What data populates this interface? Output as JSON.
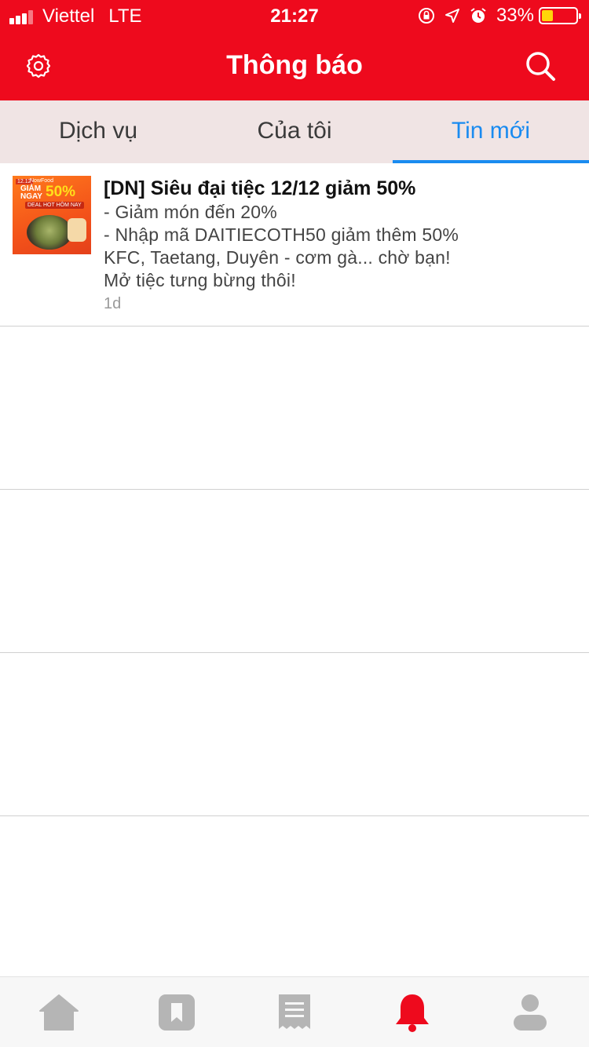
{
  "status_bar": {
    "carrier": "Viettel",
    "network": "LTE",
    "time": "21:27",
    "battery": "33%",
    "battery_level": 0.33
  },
  "header": {
    "title": "Thông báo",
    "bg_color": "#ee0a1d",
    "left_icon": "gear-icon",
    "right_icon": "search-icon"
  },
  "tabs": [
    {
      "label": "Dịch vụ"
    },
    {
      "label": "Của tôi"
    },
    {
      "label": "Tin mới",
      "active": true
    }
  ],
  "notifications": [
    {
      "thumbnail": {
        "tag": "12.12",
        "brand": "NowFood",
        "line1": "GIẢM",
        "line2": "NGAY",
        "percent": "50%",
        "deal": "DEAL HOT HÔM NAY"
      },
      "title": "[DN] Siêu đại tiệc 12/12 giảm 50%",
      "lines": [
        "- Giảm món đến 20%",
        "- Nhập mã DAITIECOTH50 giảm thêm 50%",
        "KFC, Taetang, Duyên - cơm gà... chờ bạn!",
        "Mở tiệc tưng bừng thôi!"
      ],
      "time_ago": "1d"
    }
  ],
  "bottom_tabs": [
    {
      "icon": "home-icon",
      "active": false
    },
    {
      "icon": "bookmark-icon",
      "active": false
    },
    {
      "icon": "receipt-icon",
      "active": false
    },
    {
      "icon": "bell-icon",
      "active": true
    },
    {
      "icon": "profile-icon",
      "active": false
    }
  ],
  "colors": {
    "accent": "#1a8bf0",
    "active_icon": "#ee0a1d",
    "inactive_icon": "#b5b5b5"
  }
}
